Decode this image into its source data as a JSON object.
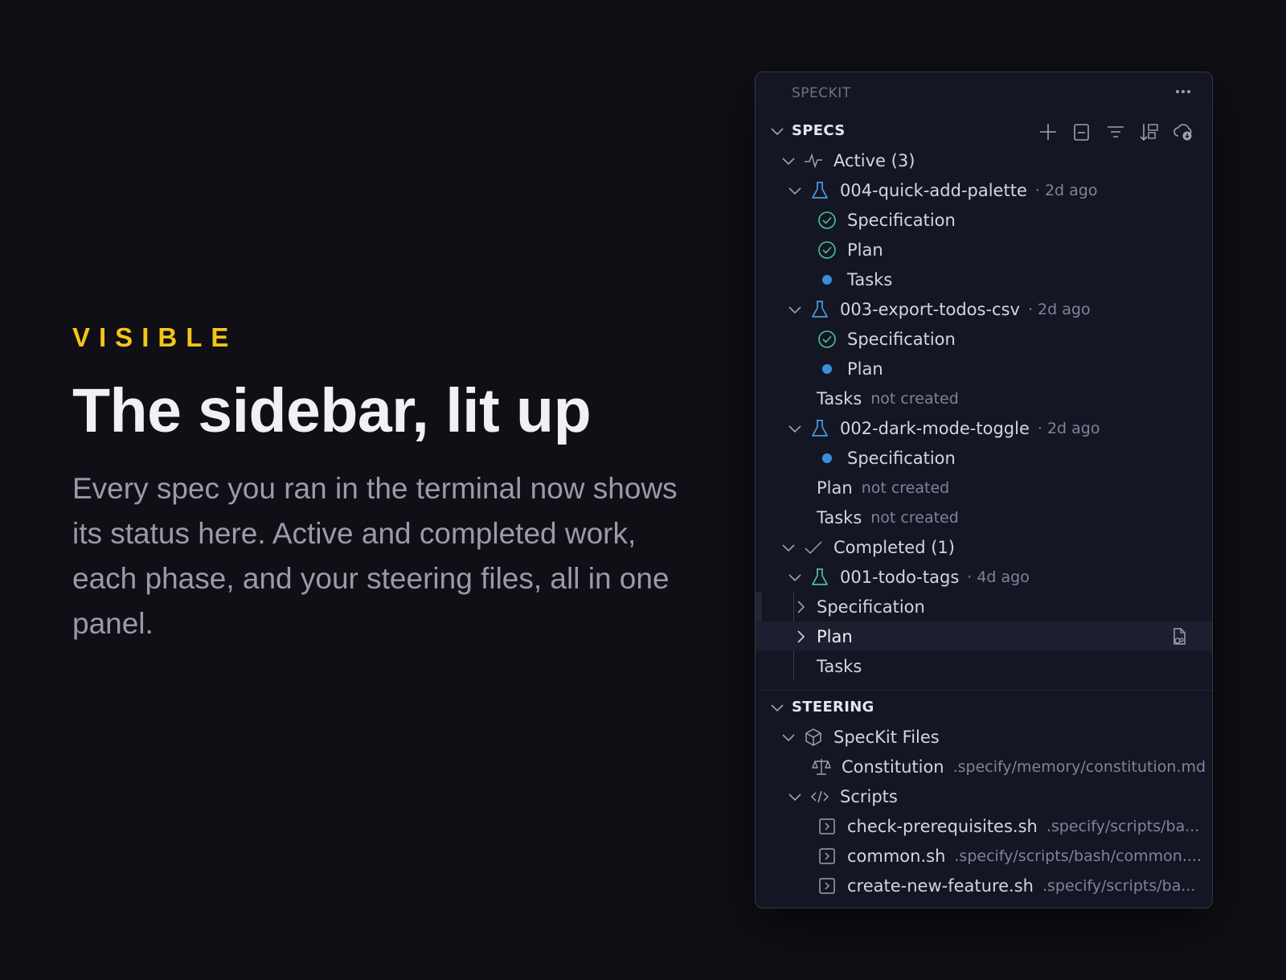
{
  "hero": {
    "eyebrow": "VISIBLE",
    "headline": "The sidebar, lit up",
    "body": "Every spec you ran in the terminal now shows its status here. Active and completed work, each phase, and your steering files, all in one panel."
  },
  "panel": {
    "title": "SPECKIT",
    "specs": {
      "section_label": "SPECS",
      "toolbar_icons": [
        "add-icon",
        "collapse-all-icon",
        "filter-icon",
        "sort-icon",
        "cloud-download-icon"
      ],
      "active_label": "Active (3)",
      "completed_label": "Completed (1)",
      "specs": [
        {
          "name": "004-quick-add-palette",
          "age": "· 2d ago",
          "phases": [
            {
              "label": "Specification",
              "status": "done"
            },
            {
              "label": "Plan",
              "status": "done"
            },
            {
              "label": "Tasks",
              "status": "in-progress"
            }
          ]
        },
        {
          "name": "003-export-todos-csv",
          "age": "· 2d ago",
          "phases": [
            {
              "label": "Specification",
              "status": "done"
            },
            {
              "label": "Plan",
              "status": "in-progress"
            },
            {
              "label": "Tasks",
              "status": "not-created",
              "note": "not created"
            }
          ]
        },
        {
          "name": "002-dark-mode-toggle",
          "age": "· 2d ago",
          "phases": [
            {
              "label": "Specification",
              "status": "in-progress"
            },
            {
              "label": "Plan",
              "status": "not-created",
              "note": "not created"
            },
            {
              "label": "Tasks",
              "status": "not-created",
              "note": "not created"
            }
          ]
        },
        {
          "name": "001-todo-tags",
          "age": "· 4d ago",
          "phases": [
            {
              "label": "Specification",
              "status": "collapsed"
            },
            {
              "label": "Plan",
              "status": "collapsed-selected"
            },
            {
              "label": "Tasks",
              "status": "plain"
            }
          ]
        }
      ]
    },
    "steering": {
      "section_label": "STEERING",
      "speckit_files_label": "SpecKit Files",
      "constitution": {
        "label": "Constitution",
        "path": ".specify/memory/constitution.md"
      },
      "scripts_label": "Scripts",
      "scripts": [
        {
          "name": "check-prerequisites.sh",
          "path": ".specify/scripts/ba..."
        },
        {
          "name": "common.sh",
          "path": ".specify/scripts/bash/common...."
        },
        {
          "name": "create-new-feature.sh",
          "path": ".specify/scripts/ba..."
        }
      ]
    }
  },
  "colors": {
    "eyebrow": "#f5c518",
    "spec_flask_active": "#4a9be0",
    "spec_flask_completed": "#4fc296",
    "status_done": "#4fc296",
    "status_in_progress": "#3b8fd9"
  }
}
